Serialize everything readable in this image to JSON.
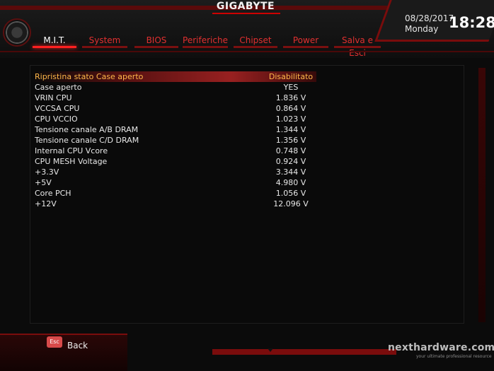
{
  "header": {
    "logo": "GIGABYTE",
    "date": "08/28/2017",
    "day": "Monday",
    "time": "18:28"
  },
  "tabs": [
    {
      "label": "M.I.T.",
      "active": true
    },
    {
      "label": "System"
    },
    {
      "label": "BIOS"
    },
    {
      "label": "Periferiche"
    },
    {
      "label": "Chipset"
    },
    {
      "label": "Power"
    },
    {
      "label": "Salva e Esci"
    }
  ],
  "rows": [
    {
      "label": "Ripristina stato Case aperto",
      "value": "Disabilitato"
    },
    {
      "label": "Case aperto",
      "value": "YES"
    },
    {
      "label": "VRIN CPU",
      "value": "1.836 V"
    },
    {
      "label": "VCCSA CPU",
      "value": "0.864 V"
    },
    {
      "label": "CPU VCCIO",
      "value": "1.023 V"
    },
    {
      "label": "Tensione canale A/B DRAM",
      "value": "1.344 V"
    },
    {
      "label": "Tensione canale C/D DRAM",
      "value": "1.356 V"
    },
    {
      "label": "Internal CPU Vcore",
      "value": "0.748 V"
    },
    {
      "label": "CPU MESH Voltage",
      "value": "0.924 V"
    },
    {
      "label": "+3.3V",
      "value": "3.344 V"
    },
    {
      "label": "+5V",
      "value": "4.980 V"
    },
    {
      "label": "Core PCH",
      "value": "1.056 V"
    },
    {
      "label": "+12V",
      "value": "12.096 V"
    }
  ],
  "footer": {
    "esc_key": "Esc",
    "back_label": "Back",
    "watermark": "nexthardware.com",
    "watermark_tag": "your ultimate professional resource"
  },
  "colors": {
    "accent": "#ff2020",
    "highlight_text": "#ffb84a"
  }
}
